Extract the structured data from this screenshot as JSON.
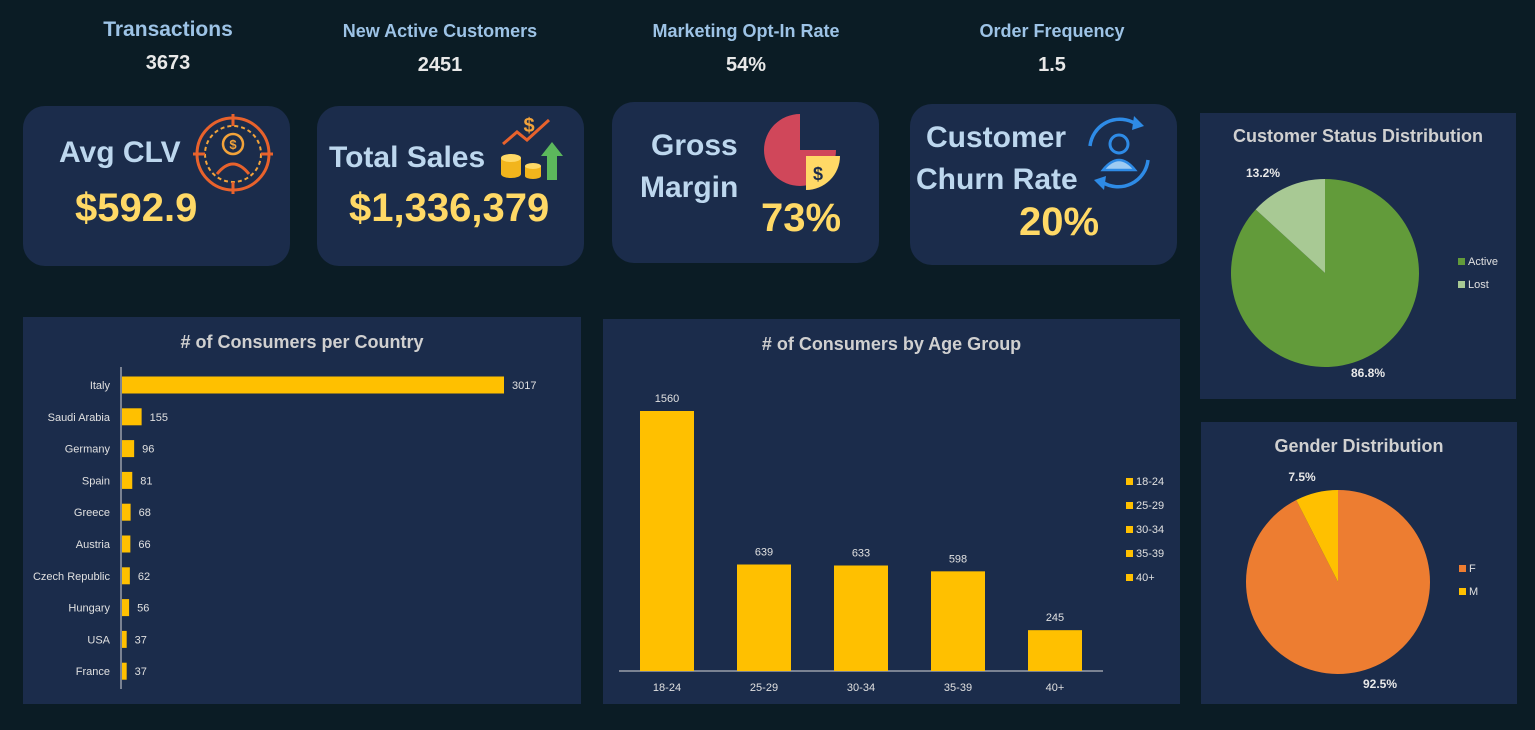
{
  "top_kpis": [
    {
      "label": "Transactions",
      "value": "3673"
    },
    {
      "label": "New Active Customers",
      "value": "2451"
    },
    {
      "label": "Marketing Opt-In Rate",
      "value": "54%"
    },
    {
      "label": "Order Frequency",
      "value": "1.5"
    }
  ],
  "cards": {
    "clv": {
      "title": "Avg CLV",
      "value": "$592.9",
      "icon": "money-target-icon"
    },
    "sales": {
      "title": "Total Sales",
      "value": "$1,336,379",
      "icon": "sales-growth-icon"
    },
    "margin": {
      "title1": "Gross",
      "title2": "Margin",
      "value": "73%",
      "icon": "pie-dollar-icon"
    },
    "churn": {
      "title1": "Customer",
      "title2": "Churn Rate",
      "value": "20%",
      "icon": "customer-cycle-icon"
    }
  },
  "colors": {
    "bar": "#ffc000",
    "active": "#629b3a",
    "lost": "#a8c994",
    "female": "#ed7d31",
    "male": "#ffc000",
    "panel": "#1b2c4b",
    "kpi_value": "#ffd966"
  },
  "chart_data": [
    {
      "type": "bar",
      "orientation": "horizontal",
      "title": "# of Consumers per Country",
      "categories": [
        "Italy",
        "Saudi Arabia",
        "Germany",
        "Spain",
        "Greece",
        "Austria",
        "Czech Republic",
        "Hungary",
        "USA",
        "France"
      ],
      "values": [
        3017,
        155,
        96,
        81,
        68,
        66,
        62,
        56,
        37,
        37
      ]
    },
    {
      "type": "bar",
      "title": "# of Consumers by Age Group",
      "categories": [
        "18-24",
        "25-29",
        "30-34",
        "35-39",
        "40+"
      ],
      "values": [
        1560,
        639,
        633,
        598,
        245
      ],
      "legend": [
        "18-24",
        "25-29",
        "30-34",
        "35-39",
        "40+"
      ],
      "legend_position": "right"
    },
    {
      "type": "pie",
      "title": "Customer Status Distribution",
      "labels": [
        "Active",
        "Lost"
      ],
      "values": [
        86.8,
        13.2
      ],
      "value_labels": [
        "86.8%",
        "13.2%"
      ],
      "legend_position": "right"
    },
    {
      "type": "pie",
      "title": "Gender Distribution",
      "labels": [
        "F",
        "M"
      ],
      "values": [
        92.5,
        7.5
      ],
      "value_labels": [
        "92.5%",
        "7.5%"
      ],
      "legend_position": "right"
    }
  ]
}
